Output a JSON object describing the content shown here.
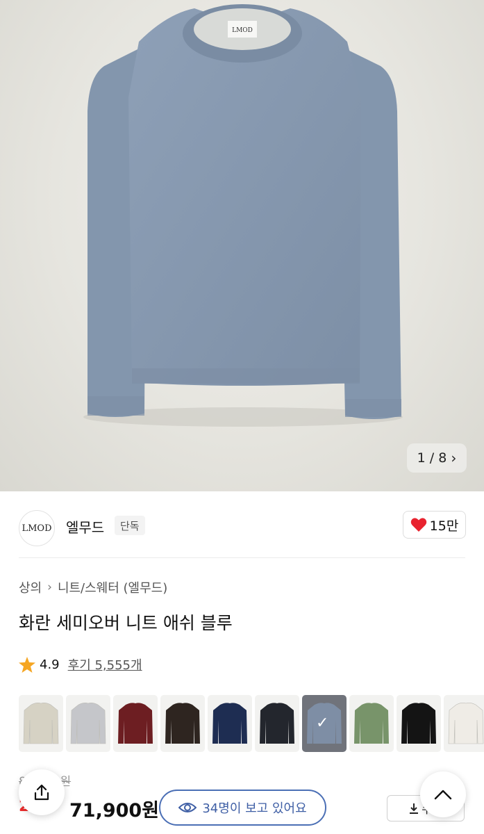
{
  "gallery": {
    "pager_text": "1 / 8",
    "next_icon": "chevron-right-icon"
  },
  "brand": {
    "logo_text": "LMOD",
    "name": "엘무드",
    "tag": "단독"
  },
  "like": {
    "count": "15만",
    "icon": "heart-icon",
    "color": "#e8232f"
  },
  "breadcrumb": {
    "level1": "상의",
    "level2": "니트/스웨터 (엘무드)"
  },
  "product": {
    "title": "화란 세미오버 니트 애쉬 블루"
  },
  "rating": {
    "score": "4.9",
    "reviews": "후기 5,555개",
    "icon": "star-icon",
    "star_color": "#f5a623"
  },
  "swatches": [
    {
      "name": "beige",
      "color": "#d6d2c4"
    },
    {
      "name": "light-gray",
      "color": "#c5c6ca"
    },
    {
      "name": "burgundy",
      "color": "#6d1e22"
    },
    {
      "name": "dark-brown",
      "color": "#2e2520"
    },
    {
      "name": "navy",
      "color": "#1e2d52"
    },
    {
      "name": "charcoal",
      "color": "#23262d"
    },
    {
      "name": "ash-blue",
      "color": "#7e8ea5",
      "selected": true
    },
    {
      "name": "olive-green",
      "color": "#78946a"
    },
    {
      "name": "black",
      "color": "#141414"
    },
    {
      "name": "ivory",
      "color": "#efece6"
    }
  ],
  "pricing": {
    "original": "89,900원",
    "discount": "20%",
    "price": "71,900원"
  },
  "viewers": {
    "text": "34명이 보고 있어요",
    "icon": "eye-icon"
  },
  "coupon": {
    "label": "쿠폰",
    "icon": "download-icon"
  },
  "fabs": {
    "share_icon": "share-icon",
    "top_icon": "chevron-up-icon"
  }
}
